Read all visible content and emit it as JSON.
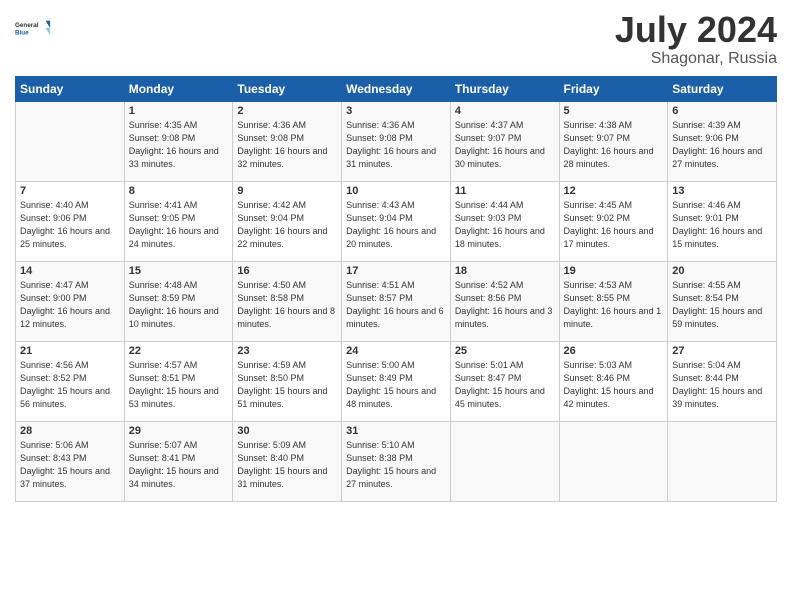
{
  "header": {
    "logo_general": "General",
    "logo_blue": "Blue",
    "title": "July 2024",
    "location": "Shagonar, Russia"
  },
  "days_of_week": [
    "Sunday",
    "Monday",
    "Tuesday",
    "Wednesday",
    "Thursday",
    "Friday",
    "Saturday"
  ],
  "weeks": [
    [
      {
        "day": "",
        "sunrise": "",
        "sunset": "",
        "daylight": ""
      },
      {
        "day": "1",
        "sunrise": "Sunrise: 4:35 AM",
        "sunset": "Sunset: 9:08 PM",
        "daylight": "Daylight: 16 hours and 33 minutes."
      },
      {
        "day": "2",
        "sunrise": "Sunrise: 4:36 AM",
        "sunset": "Sunset: 9:08 PM",
        "daylight": "Daylight: 16 hours and 32 minutes."
      },
      {
        "day": "3",
        "sunrise": "Sunrise: 4:36 AM",
        "sunset": "Sunset: 9:08 PM",
        "daylight": "Daylight: 16 hours and 31 minutes."
      },
      {
        "day": "4",
        "sunrise": "Sunrise: 4:37 AM",
        "sunset": "Sunset: 9:07 PM",
        "daylight": "Daylight: 16 hours and 30 minutes."
      },
      {
        "day": "5",
        "sunrise": "Sunrise: 4:38 AM",
        "sunset": "Sunset: 9:07 PM",
        "daylight": "Daylight: 16 hours and 28 minutes."
      },
      {
        "day": "6",
        "sunrise": "Sunrise: 4:39 AM",
        "sunset": "Sunset: 9:06 PM",
        "daylight": "Daylight: 16 hours and 27 minutes."
      }
    ],
    [
      {
        "day": "7",
        "sunrise": "Sunrise: 4:40 AM",
        "sunset": "Sunset: 9:06 PM",
        "daylight": "Daylight: 16 hours and 25 minutes."
      },
      {
        "day": "8",
        "sunrise": "Sunrise: 4:41 AM",
        "sunset": "Sunset: 9:05 PM",
        "daylight": "Daylight: 16 hours and 24 minutes."
      },
      {
        "day": "9",
        "sunrise": "Sunrise: 4:42 AM",
        "sunset": "Sunset: 9:04 PM",
        "daylight": "Daylight: 16 hours and 22 minutes."
      },
      {
        "day": "10",
        "sunrise": "Sunrise: 4:43 AM",
        "sunset": "Sunset: 9:04 PM",
        "daylight": "Daylight: 16 hours and 20 minutes."
      },
      {
        "day": "11",
        "sunrise": "Sunrise: 4:44 AM",
        "sunset": "Sunset: 9:03 PM",
        "daylight": "Daylight: 16 hours and 18 minutes."
      },
      {
        "day": "12",
        "sunrise": "Sunrise: 4:45 AM",
        "sunset": "Sunset: 9:02 PM",
        "daylight": "Daylight: 16 hours and 17 minutes."
      },
      {
        "day": "13",
        "sunrise": "Sunrise: 4:46 AM",
        "sunset": "Sunset: 9:01 PM",
        "daylight": "Daylight: 16 hours and 15 minutes."
      }
    ],
    [
      {
        "day": "14",
        "sunrise": "Sunrise: 4:47 AM",
        "sunset": "Sunset: 9:00 PM",
        "daylight": "Daylight: 16 hours and 12 minutes."
      },
      {
        "day": "15",
        "sunrise": "Sunrise: 4:48 AM",
        "sunset": "Sunset: 8:59 PM",
        "daylight": "Daylight: 16 hours and 10 minutes."
      },
      {
        "day": "16",
        "sunrise": "Sunrise: 4:50 AM",
        "sunset": "Sunset: 8:58 PM",
        "daylight": "Daylight: 16 hours and 8 minutes."
      },
      {
        "day": "17",
        "sunrise": "Sunrise: 4:51 AM",
        "sunset": "Sunset: 8:57 PM",
        "daylight": "Daylight: 16 hours and 6 minutes."
      },
      {
        "day": "18",
        "sunrise": "Sunrise: 4:52 AM",
        "sunset": "Sunset: 8:56 PM",
        "daylight": "Daylight: 16 hours and 3 minutes."
      },
      {
        "day": "19",
        "sunrise": "Sunrise: 4:53 AM",
        "sunset": "Sunset: 8:55 PM",
        "daylight": "Daylight: 16 hours and 1 minute."
      },
      {
        "day": "20",
        "sunrise": "Sunrise: 4:55 AM",
        "sunset": "Sunset: 8:54 PM",
        "daylight": "Daylight: 15 hours and 59 minutes."
      }
    ],
    [
      {
        "day": "21",
        "sunrise": "Sunrise: 4:56 AM",
        "sunset": "Sunset: 8:52 PM",
        "daylight": "Daylight: 15 hours and 56 minutes."
      },
      {
        "day": "22",
        "sunrise": "Sunrise: 4:57 AM",
        "sunset": "Sunset: 8:51 PM",
        "daylight": "Daylight: 15 hours and 53 minutes."
      },
      {
        "day": "23",
        "sunrise": "Sunrise: 4:59 AM",
        "sunset": "Sunset: 8:50 PM",
        "daylight": "Daylight: 15 hours and 51 minutes."
      },
      {
        "day": "24",
        "sunrise": "Sunrise: 5:00 AM",
        "sunset": "Sunset: 8:49 PM",
        "daylight": "Daylight: 15 hours and 48 minutes."
      },
      {
        "day": "25",
        "sunrise": "Sunrise: 5:01 AM",
        "sunset": "Sunset: 8:47 PM",
        "daylight": "Daylight: 15 hours and 45 minutes."
      },
      {
        "day": "26",
        "sunrise": "Sunrise: 5:03 AM",
        "sunset": "Sunset: 8:46 PM",
        "daylight": "Daylight: 15 hours and 42 minutes."
      },
      {
        "day": "27",
        "sunrise": "Sunrise: 5:04 AM",
        "sunset": "Sunset: 8:44 PM",
        "daylight": "Daylight: 15 hours and 39 minutes."
      }
    ],
    [
      {
        "day": "28",
        "sunrise": "Sunrise: 5:06 AM",
        "sunset": "Sunset: 8:43 PM",
        "daylight": "Daylight: 15 hours and 37 minutes."
      },
      {
        "day": "29",
        "sunrise": "Sunrise: 5:07 AM",
        "sunset": "Sunset: 8:41 PM",
        "daylight": "Daylight: 15 hours and 34 minutes."
      },
      {
        "day": "30",
        "sunrise": "Sunrise: 5:09 AM",
        "sunset": "Sunset: 8:40 PM",
        "daylight": "Daylight: 15 hours and 31 minutes."
      },
      {
        "day": "31",
        "sunrise": "Sunrise: 5:10 AM",
        "sunset": "Sunset: 8:38 PM",
        "daylight": "Daylight: 15 hours and 27 minutes."
      },
      {
        "day": "",
        "sunrise": "",
        "sunset": "",
        "daylight": ""
      },
      {
        "day": "",
        "sunrise": "",
        "sunset": "",
        "daylight": ""
      },
      {
        "day": "",
        "sunrise": "",
        "sunset": "",
        "daylight": ""
      }
    ]
  ]
}
